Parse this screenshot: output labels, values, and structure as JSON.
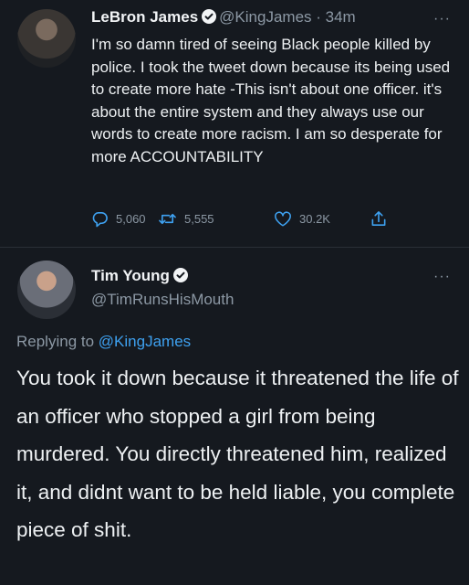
{
  "tweet": {
    "author_name": "LeBron James",
    "author_handle": "@KingJames",
    "time": "· 34m",
    "more_label": "···",
    "text": "I'm so damn tired of seeing Black people killed by police. I took the tweet down because its being used to create more hate -This isn't about one officer. it's about the entire system and they always use our words to create more racism. I am so desperate for more ACCOUNTABILITY",
    "replies": "5,060",
    "retweets": "5,555",
    "likes": "30.2K"
  },
  "reply": {
    "author_name": "Tim Young",
    "author_handle": "@TimRunsHisMouth",
    "more_label": "···",
    "replying_prefix": "Replying to",
    "replying_to": "@KingJames",
    "text": "You took it down because it threatened the life of an officer who stopped a girl from being murdered. You directly threatened him, realized it, and didnt want to be held liable, you complete piece of shit."
  },
  "colors": {
    "background": "#15191f",
    "accent": "#3ea1f0",
    "muted": "#8c98a4"
  }
}
